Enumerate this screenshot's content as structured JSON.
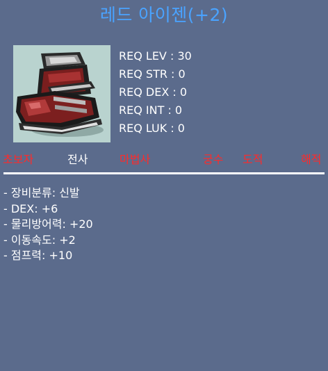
{
  "item": {
    "title": "레드 아이젠(+2)",
    "icon": "red-boots-icon"
  },
  "requirements": [
    "REQ LEV : 30",
    "REQ STR : 0",
    "REQ DEX : 0",
    "REQ INT : 0",
    "REQ LUK : 0"
  ],
  "classes": [
    {
      "label": "초보자",
      "met": false
    },
    {
      "label": "전사",
      "met": true
    },
    {
      "label": "마법사",
      "met": false
    },
    {
      "label": "궁수",
      "met": false
    },
    {
      "label": "도적",
      "met": false
    },
    {
      "label": "해적",
      "met": false
    }
  ],
  "stats": [
    "- 장비분류: 신발",
    "- DEX: +6",
    "- 물리방어력: +20",
    "- 이동속도: +2",
    "- 점프력: +10"
  ],
  "colors": {
    "background": "#5b6b8c",
    "title": "#4aa3ff",
    "unmet_class": "#ff2a2a",
    "met_class": "#ffffff",
    "icon_frame": "#b9d3cf"
  }
}
